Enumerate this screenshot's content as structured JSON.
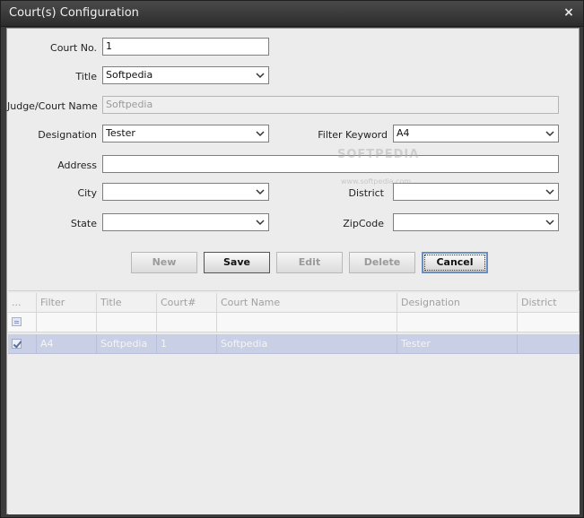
{
  "window": {
    "title": "Court(s) Configuration",
    "close_glyph": "×"
  },
  "form": {
    "court_no": {
      "label": "Court No.",
      "value": "1"
    },
    "title": {
      "label": "Title",
      "value": "Softpedia"
    },
    "judge": {
      "label": "Judge/Court Name",
      "value": "Softpedia"
    },
    "designation": {
      "label": "Designation",
      "value": "Tester"
    },
    "filter_keyword": {
      "label": "Filter Keyword",
      "value": "A4"
    },
    "address": {
      "label": "Address",
      "value": ""
    },
    "city": {
      "label": "City",
      "value": ""
    },
    "district": {
      "label": "District",
      "value": ""
    },
    "state": {
      "label": "State",
      "value": ""
    },
    "zipcode": {
      "label": "ZipCode",
      "value": ""
    }
  },
  "buttons": {
    "new": "New",
    "save": "Save",
    "edit": "Edit",
    "delete": "Delete",
    "cancel": "Cancel"
  },
  "grid": {
    "columns": [
      "...",
      "Filter",
      "Title",
      "Court#",
      "Court Name",
      "Designation",
      "District"
    ],
    "rows": [
      {
        "checked": true,
        "filter": "A4",
        "title": "Softpedia",
        "court": "1",
        "court_name": "Softpedia",
        "designation": "Tester",
        "district": ""
      }
    ]
  },
  "watermark": {
    "line1": "SOFTPEDIA",
    "line2": "www.softpedia.com"
  },
  "icons": {
    "combo_arrow": "chevron-down-icon",
    "close": "close-icon",
    "checkbox": "checkbox-icon",
    "filter_row": "filter-row-icon"
  }
}
